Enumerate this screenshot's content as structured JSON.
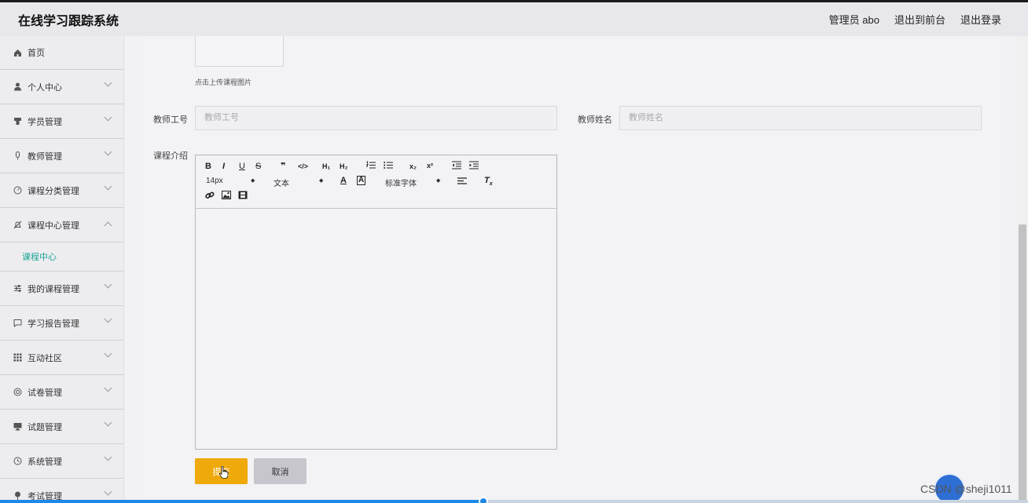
{
  "header": {
    "title": "在线学习跟踪系统",
    "admin": "管理员 abo",
    "to_front": "退出到前台",
    "logout": "退出登录"
  },
  "sidebar": {
    "items": [
      {
        "label": "首页",
        "icon": "home-icon"
      },
      {
        "label": "个人中心",
        "icon": "user-icon"
      },
      {
        "label": "学员管理",
        "icon": "student-icon"
      },
      {
        "label": "教师管理",
        "icon": "mic-icon"
      },
      {
        "label": "课程分类管理",
        "icon": "gauge-icon"
      },
      {
        "label": "课程中心管理",
        "icon": "bell-off-icon"
      },
      {
        "label": "我的课程管理",
        "icon": "sliders-icon"
      },
      {
        "label": "学习报告管理",
        "icon": "chat-icon"
      },
      {
        "label": "互动社区",
        "icon": "grid-icon"
      },
      {
        "label": "试卷管理",
        "icon": "circle-icon"
      },
      {
        "label": "试题管理",
        "icon": "monitor-icon"
      },
      {
        "label": "系统管理",
        "icon": "clock-icon"
      },
      {
        "label": "考试管理",
        "icon": "pin-icon"
      }
    ],
    "sub_item": "课程中心"
  },
  "form": {
    "upload_hint": "点击上传课程图片",
    "teacher_id_label": "教师工号",
    "teacher_id_placeholder": "教师工号",
    "teacher_name_label": "教师姓名",
    "teacher_name_placeholder": "教师姓名",
    "intro_label": "课程介绍",
    "editor": {
      "font_size": "14px",
      "text_style": "文本",
      "font_family": "标准字体"
    },
    "submit": "提交",
    "cancel": "取消"
  },
  "watermark": "CSDN @sheji1011",
  "video_progress": 0.47
}
